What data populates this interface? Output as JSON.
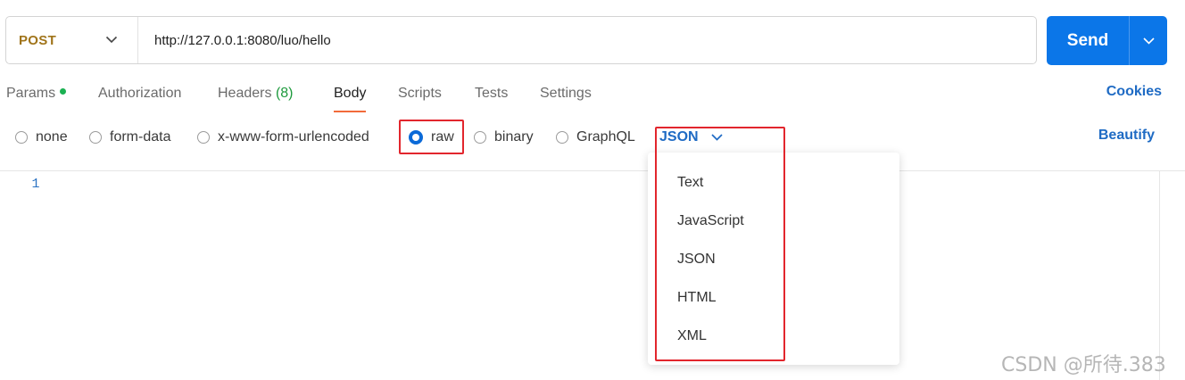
{
  "request": {
    "method": "POST",
    "url": "http://127.0.0.1:8080/luo/hello",
    "send_label": "Send"
  },
  "tabs": [
    {
      "label": "Params",
      "has_dot": true
    },
    {
      "label": "Authorization"
    },
    {
      "label": "Headers",
      "count": "(8)"
    },
    {
      "label": "Body",
      "active": true
    },
    {
      "label": "Scripts"
    },
    {
      "label": "Tests"
    },
    {
      "label": "Settings"
    }
  ],
  "cookies_label": "Cookies",
  "body_types": [
    {
      "label": "none",
      "checked": false
    },
    {
      "label": "form-data",
      "checked": false
    },
    {
      "label": "x-www-form-urlencoded",
      "checked": false
    },
    {
      "label": "raw",
      "checked": true
    },
    {
      "label": "binary",
      "checked": false
    },
    {
      "label": "GraphQL",
      "checked": false
    }
  ],
  "language_select": {
    "selected": "JSON",
    "options": [
      "Text",
      "JavaScript",
      "JSON",
      "HTML",
      "XML"
    ]
  },
  "beautify_label": "Beautify",
  "editor": {
    "line_numbers": [
      "1"
    ]
  },
  "watermark": "CSDN @所待.383",
  "colors": {
    "accent": "#0b76e8",
    "method_post": "#a0741a",
    "link": "#1f6bc4",
    "active_tab_underline": "#f26b3a",
    "highlight_box": "#e2262d",
    "params_dot": "#1bb152",
    "headers_count": "#1e9a3d"
  }
}
